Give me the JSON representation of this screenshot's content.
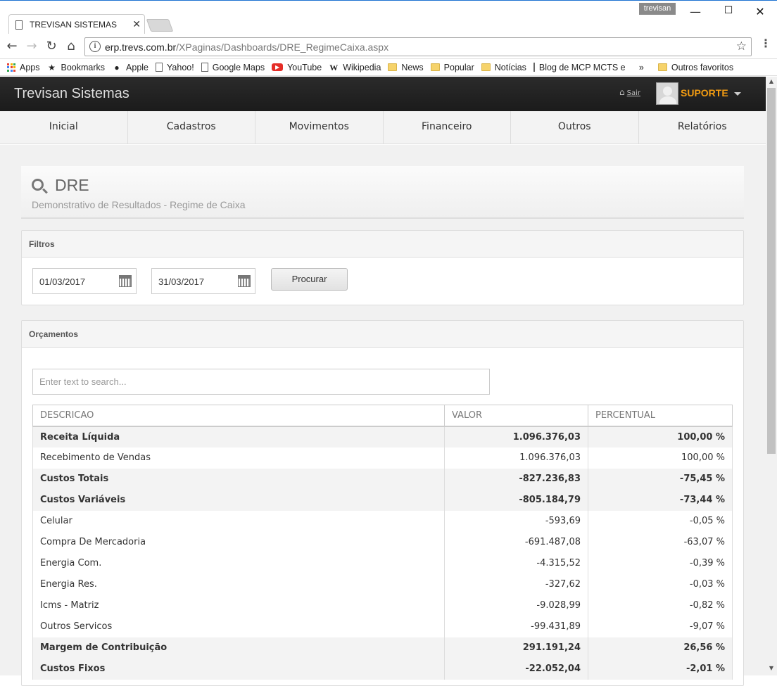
{
  "browser": {
    "tab_title": "TREVISAN SISTEMAS",
    "profile": "trevisan",
    "url_domain": "erp.trevs.com.br",
    "url_path": "/XPaginas/Dashboards/DRE_RegimeCaixa.aspx",
    "bookmarks": [
      {
        "label": "Apps",
        "icon": "apps-grid-icon"
      },
      {
        "label": "Bookmarks",
        "icon": "star-icon"
      },
      {
        "label": "Apple",
        "icon": "apple-icon"
      },
      {
        "label": "Yahoo!",
        "icon": "page-icon"
      },
      {
        "label": "Google Maps",
        "icon": "page-icon"
      },
      {
        "label": "YouTube",
        "icon": "youtube-icon"
      },
      {
        "label": "Wikipedia",
        "icon": "wikipedia-icon"
      },
      {
        "label": "News",
        "icon": "folder-icon"
      },
      {
        "label": "Popular",
        "icon": "folder-icon"
      },
      {
        "label": "Notícias",
        "icon": "folder-icon"
      },
      {
        "label": "Blog de MCP MCTS e",
        "icon": "page-icon"
      }
    ],
    "overflow": "»",
    "other_bookmarks": "Outros favoritos"
  },
  "header": {
    "brand": "Trevisan Sistemas",
    "logout": "Sair",
    "user": "SUPORTE"
  },
  "nav": [
    "Inicial",
    "Cadastros",
    "Movimentos",
    "Financeiro",
    "Outros",
    "Relatórios"
  ],
  "page": {
    "title": "DRE",
    "subtitle": "Demonstrativo de Resultados - Regime de Caixa"
  },
  "filters": {
    "heading": "Filtros",
    "date_from": "01/03/2017",
    "date_to": "31/03/2017",
    "search_button": "Procurar"
  },
  "budgets": {
    "heading": "Orçamentos",
    "search_placeholder": "Enter text to search...",
    "columns": [
      "DESCRICAO",
      "VALOR",
      "PERCENTUAL"
    ],
    "rows": [
      {
        "desc": "Receita Líquida",
        "value": "1.096.376,03",
        "pct": "100,00 %",
        "bold": true
      },
      {
        "desc": "Recebimento de Vendas",
        "value": "1.096.376,03",
        "pct": "100,00 %",
        "bold": false
      },
      {
        "desc": "Custos Totais",
        "value": "-827.236,83",
        "pct": "-75,45 %",
        "bold": true
      },
      {
        "desc": "Custos Variáveis",
        "value": "-805.184,79",
        "pct": "-73,44 %",
        "bold": true
      },
      {
        "desc": "Celular",
        "value": "-593,69",
        "pct": "-0,05 %",
        "bold": false
      },
      {
        "desc": "Compra De Mercadoria",
        "value": "-691.487,08",
        "pct": "-63,07 %",
        "bold": false
      },
      {
        "desc": "Energia Com.",
        "value": "-4.315,52",
        "pct": "-0,39 %",
        "bold": false
      },
      {
        "desc": "Energia Res.",
        "value": "-327,62",
        "pct": "-0,03 %",
        "bold": false
      },
      {
        "desc": "Icms - Matriz",
        "value": "-9.028,99",
        "pct": "-0,82 %",
        "bold": false
      },
      {
        "desc": "Outros Servicos",
        "value": "-99.431,89",
        "pct": "-9,07 %",
        "bold": false
      },
      {
        "desc": "Margem de Contribuição",
        "value": "291.191,24",
        "pct": "26,56 %",
        "bold": true
      },
      {
        "desc": "Custos Fixos",
        "value": "-22.052,04",
        "pct": "-2,01 %",
        "bold": true
      }
    ]
  }
}
